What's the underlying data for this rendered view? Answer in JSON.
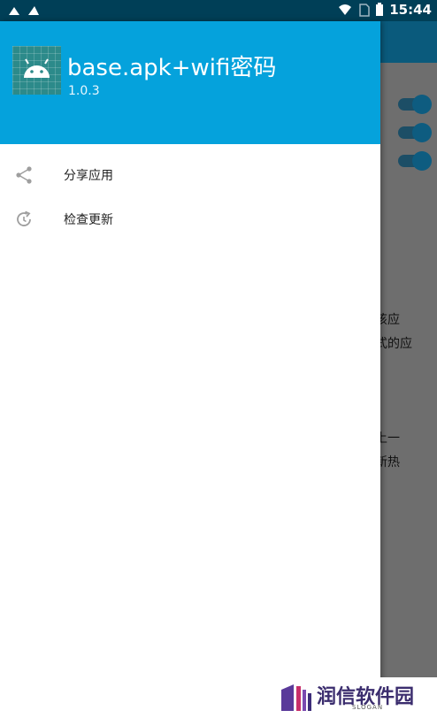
{
  "status_bar": {
    "time": "15:44"
  },
  "background": {
    "text_lines": [
      "该应",
      "式的应",
      "上一",
      "新热"
    ]
  },
  "drawer": {
    "app_name": "base.apk+wifi密码",
    "version": "1.0.3",
    "header_color": "#05a2dc",
    "menu": [
      {
        "label": "分享应用",
        "icon": "share-icon"
      },
      {
        "label": "检查更新",
        "icon": "refresh-icon"
      }
    ]
  },
  "watermark": {
    "title": "润信软件园",
    "slogan": "SLOGAN"
  }
}
